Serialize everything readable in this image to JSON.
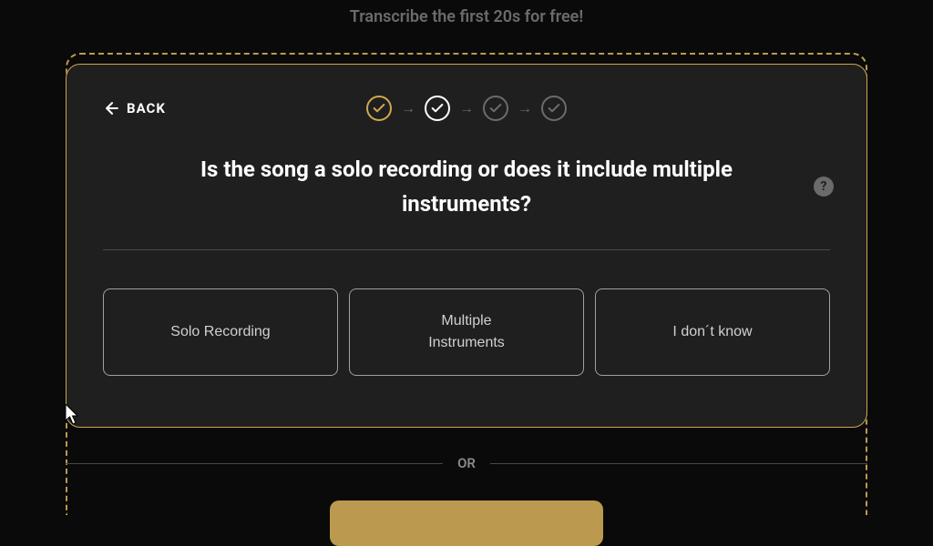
{
  "banner": {
    "text": "Transcribe the first 20s for free!"
  },
  "modal": {
    "back_label": "BACK",
    "question": "Is the song a solo recording or does it include multiple instruments?",
    "help_glyph": "?",
    "options": [
      {
        "label": "Solo Recording"
      },
      {
        "label": "Multiple\nInstruments"
      },
      {
        "label": "I don´t know"
      }
    ],
    "steps": [
      {
        "state": "active"
      },
      {
        "state": "current"
      },
      {
        "state": "pending"
      },
      {
        "state": "pending"
      }
    ]
  },
  "or_label": "OR",
  "colors": {
    "accent": "#d0a84e",
    "background": "#0a0a0a",
    "modal_bg": "#1f1f1f",
    "text": "#ffffff",
    "muted": "#6b6b6b"
  }
}
